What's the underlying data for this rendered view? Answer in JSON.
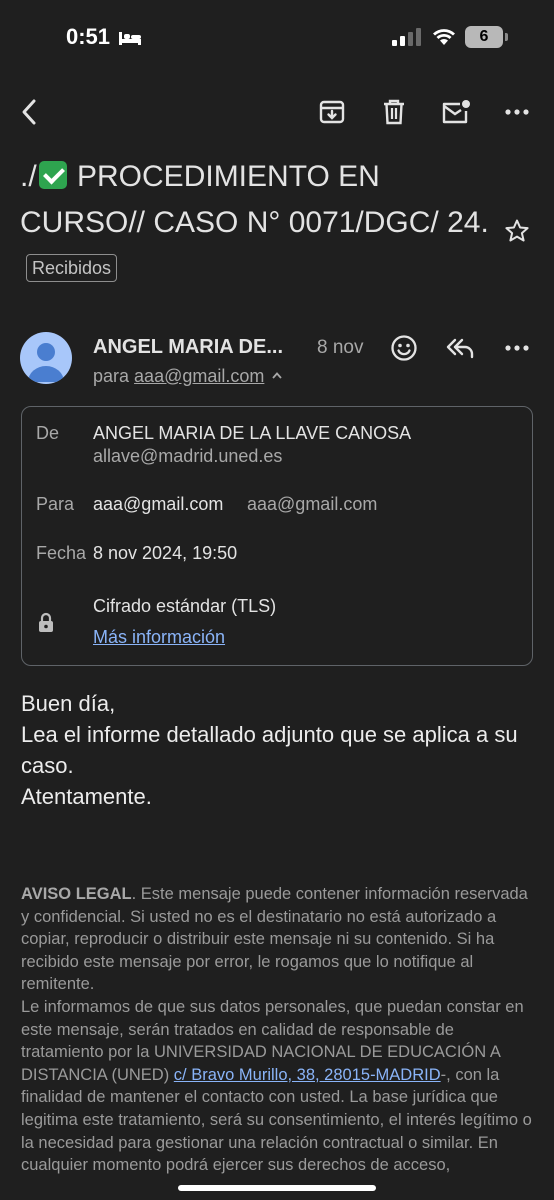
{
  "status_bar": {
    "time": "0:51",
    "battery": "6"
  },
  "toolbar": {
    "icons": [
      "back-arrow-icon",
      "archive-icon",
      "delete-icon",
      "mark-unread-icon",
      "more-icon"
    ]
  },
  "subject": {
    "prefix": "./",
    "text": " PROCEDIMIENTO EN CURSO// CASO N° 0071/DGC/ 24.",
    "label": "Recibidos"
  },
  "sender": {
    "name": "ANGEL MARIA DE...",
    "date": "8 nov",
    "to_prefix": "para",
    "to_address": "aaa@gmail.com"
  },
  "details": {
    "from_label": "De",
    "from_name": "ANGEL MARIA DE LA LLAVE CANOSA",
    "from_email": "allave@madrid.uned.es",
    "to_label": "Para",
    "to_email_1": "aaa@gmail.com",
    "to_email_2": "aaa@gmail.com",
    "date_label": "Fecha",
    "date_value": "8 nov 2024, 19:50",
    "encryption": "Cifrado estándar (TLS)",
    "more_info": "Más información"
  },
  "body": {
    "line1": "Buen día,",
    "line2": "Lea el informe detallado adjunto que se aplica a su caso.",
    "line3": "Atentamente."
  },
  "legal": {
    "title": "AVISO LEGAL",
    "p1": ". Este mensaje puede contener información reservada y confidencial. Si usted no es el destinatario no está autorizado a copiar, reproducir o distribuir este mensaje ni su contenido. Si ha recibido este mensaje por error, le rogamos que lo notifique al remitente.",
    "p2a": "Le informamos de que sus datos personales, que puedan constar en este mensaje, serán tratados en calidad de responsable de tratamiento por la UNIVERSIDAD NACIONAL DE EDUCACIÓN A DISTANCIA (UNED) ",
    "p2link": "c/ Bravo Murillo, 38, 28015-MADRID",
    "p2b": "-, con la finalidad de mantener el contacto con usted. La base jurídica que legitima este tratamiento, será su consentimiento, el interés legítimo o la necesidad para gestionar una relación contractual o similar. En cualquier momento podrá ejercer sus derechos de acceso,"
  }
}
